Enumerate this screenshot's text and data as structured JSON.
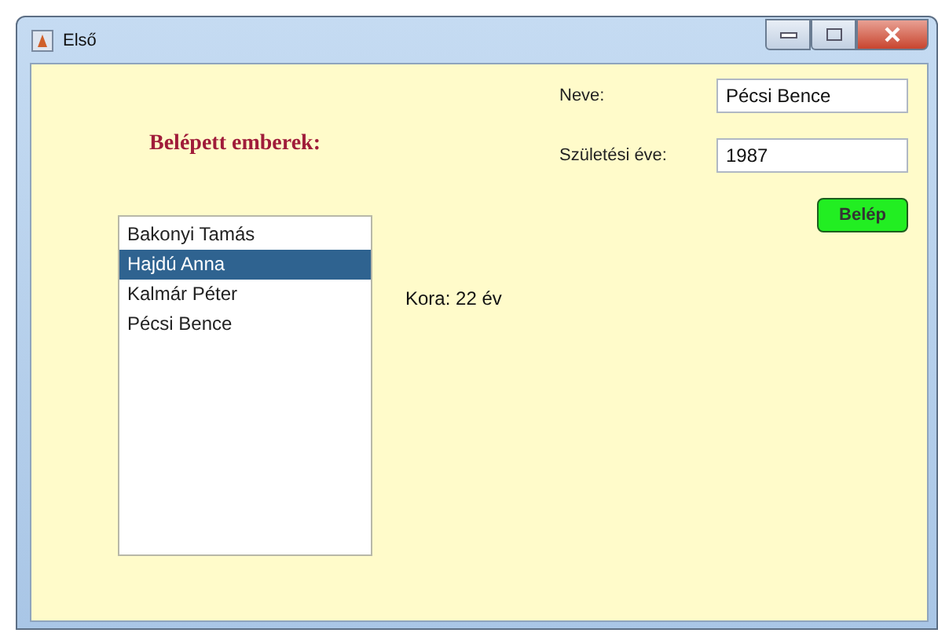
{
  "window": {
    "title": "Első"
  },
  "heading": "Belépett emberek:",
  "people": [
    {
      "name": "Bakonyi Tamás",
      "selected": false
    },
    {
      "name": "Hajdú Anna",
      "selected": true
    },
    {
      "name": "Kalmár Péter",
      "selected": false
    },
    {
      "name": "Pécsi Bence",
      "selected": false
    }
  ],
  "age_label": "Kora: 22 év",
  "fields": [
    {
      "label": "Neve:",
      "value": "Pécsi Bence"
    },
    {
      "label": "Születési éve:",
      "value": "1987"
    }
  ],
  "button": "Belép"
}
